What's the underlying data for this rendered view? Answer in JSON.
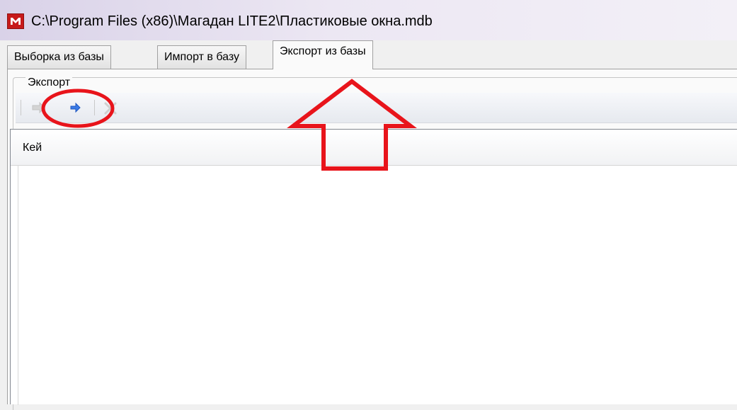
{
  "window": {
    "title": "C:\\Program Files (x86)\\Магадан LITE2\\Пластиковые окна.mdb",
    "app_icon": "app-logo-icon"
  },
  "tabs": [
    {
      "label": "Выборка из базы",
      "active": false
    },
    {
      "label": "Импорт в базу",
      "active": false
    },
    {
      "label": "Экспорт из базы",
      "active": true
    }
  ],
  "export_group": {
    "label": "Экспорт"
  },
  "toolbar": {
    "buttons": [
      {
        "name": "arrow-right-disabled-icon",
        "enabled": false
      },
      {
        "name": "arrow-right-blue-icon",
        "enabled": true
      },
      {
        "name": "delete-x-disabled-icon",
        "enabled": false
      }
    ]
  },
  "grid": {
    "columns": [
      "Кей"
    ],
    "rows": []
  },
  "colors": {
    "annotation": "#e8141b",
    "arrow_blue": "#2f6fe0"
  }
}
